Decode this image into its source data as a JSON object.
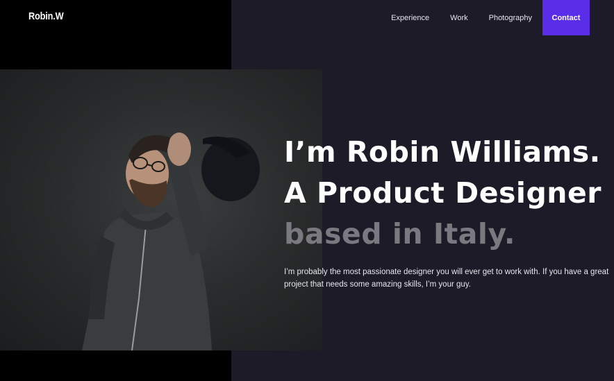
{
  "brand": {
    "logo": "Robin.W"
  },
  "nav": {
    "links": [
      "Experience",
      "Work",
      "Photography"
    ],
    "contact_label": "Contact"
  },
  "hero": {
    "line1": "I’m Robin Williams.",
    "line2": "A Product Designer",
    "line3": "based in Italy.",
    "intro": "I’m probably the most passionate designer you will ever get to work with. If you have a great project that needs some amazing skills, I’m your guy."
  },
  "colors": {
    "accent": "#5a2ee8",
    "background": "#1c1b27",
    "muted_text": "#7a7980"
  }
}
